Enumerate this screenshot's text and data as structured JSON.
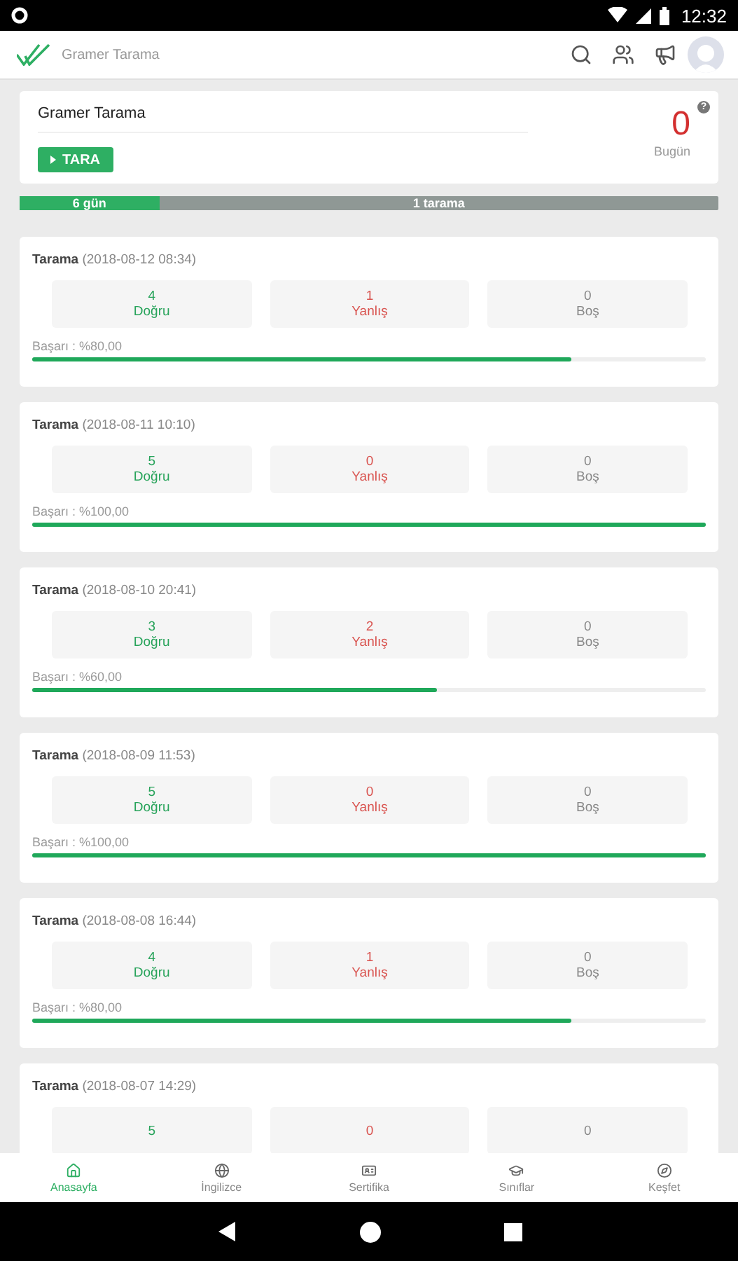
{
  "status_bar": {
    "time": "12:32"
  },
  "app_bar": {
    "title": "Gramer Tarama"
  },
  "summary": {
    "title": "Gramer Tarama",
    "button": "TARA",
    "count": "0",
    "count_label": "Bugün",
    "help": "?"
  },
  "streak": {
    "days": "6 gün",
    "scans": "1 tarama",
    "level": 0.2
  },
  "scans": [
    {
      "title": "Tarama",
      "date": "(2018-08-12 08:34)",
      "stats": [
        {
          "kind": "correct",
          "count": "4",
          "label": "Doğru"
        },
        {
          "kind": "wrong",
          "count": "1",
          "label": "Yanlış"
        },
        {
          "kind": "empty",
          "count": "0",
          "label": "Boş"
        }
      ],
      "success": "Başarı : %80,00",
      "level": 0.8
    },
    {
      "title": "Tarama",
      "date": "(2018-08-11 10:10)",
      "stats": [
        {
          "kind": "correct",
          "count": "5",
          "label": "Doğru"
        },
        {
          "kind": "wrong",
          "count": "0",
          "label": "Yanlış"
        },
        {
          "kind": "empty",
          "count": "0",
          "label": "Boş"
        }
      ],
      "success": "Başarı : %100,00",
      "level": 1
    },
    {
      "title": "Tarama",
      "date": "(2018-08-10 20:41)",
      "stats": [
        {
          "kind": "correct",
          "count": "3",
          "label": "Doğru"
        },
        {
          "kind": "wrong",
          "count": "2",
          "label": "Yanlış"
        },
        {
          "kind": "empty",
          "count": "0",
          "label": "Boş"
        }
      ],
      "success": "Başarı : %60,00",
      "level": 0.6
    },
    {
      "title": "Tarama",
      "date": "(2018-08-09 11:53)",
      "stats": [
        {
          "kind": "correct",
          "count": "5",
          "label": "Doğru"
        },
        {
          "kind": "wrong",
          "count": "0",
          "label": "Yanlış"
        },
        {
          "kind": "empty",
          "count": "0",
          "label": "Boş"
        }
      ],
      "success": "Başarı : %100,00",
      "level": 1
    },
    {
      "title": "Tarama",
      "date": "(2018-08-08 16:44)",
      "stats": [
        {
          "kind": "correct",
          "count": "4",
          "label": "Doğru"
        },
        {
          "kind": "wrong",
          "count": "1",
          "label": "Yanlış"
        },
        {
          "kind": "empty",
          "count": "0",
          "label": "Boş"
        }
      ],
      "success": "Başarı : %80,00",
      "level": 0.8
    },
    {
      "title": "Tarama",
      "date": "(2018-08-07 14:29)",
      "stats": [
        {
          "kind": "correct",
          "count": "5"
        },
        {
          "kind": "wrong",
          "count": "0"
        },
        {
          "kind": "empty",
          "count": "0"
        }
      ]
    }
  ],
  "bottom_nav": [
    {
      "kind": "home",
      "label": "Anasayfa",
      "selected": true
    },
    {
      "kind": "globe",
      "label": "İngilizce",
      "selected": false
    },
    {
      "kind": "certificate",
      "label": "Sertifika",
      "selected": false
    },
    {
      "kind": "classes",
      "label": "Sınıflar",
      "selected": false
    },
    {
      "kind": "explore",
      "label": "Keşfet",
      "selected": false
    }
  ]
}
